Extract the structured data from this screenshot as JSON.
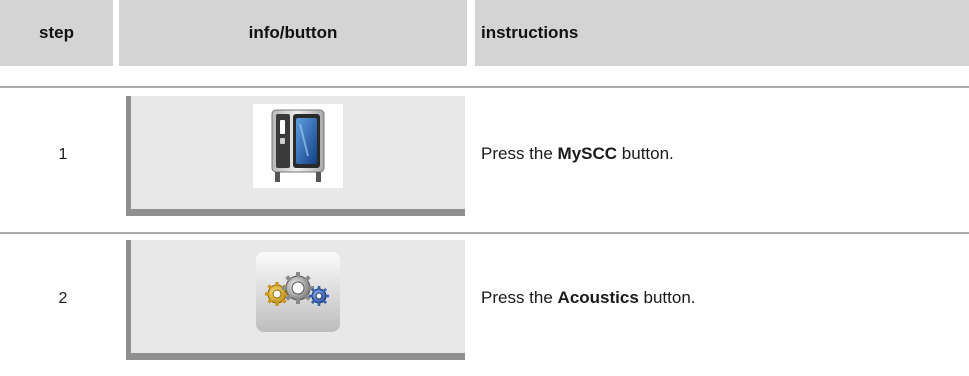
{
  "header": {
    "step_label": "step",
    "info_label": "info/button",
    "instructions_label": "instructions"
  },
  "rows": [
    {
      "step": "1",
      "icon": "myscc-oven-icon",
      "instruction_prefix": "Press the ",
      "instruction_bold": "MySCC",
      "instruction_suffix": " button."
    },
    {
      "step": "2",
      "icon": "acoustics-gears-icon",
      "instruction_prefix": "Press the ",
      "instruction_bold": "Acoustics",
      "instruction_suffix": " button."
    }
  ],
  "colors": {
    "header_bg": "#d4d4d4",
    "panel_bg": "#e8e8e8",
    "panel_border": "#8f8f8f",
    "rule": "#a9a9a9",
    "oven_window": "#1f5fae",
    "gear_gold": "#d9a520",
    "gear_silver": "#9a9a9a",
    "gear_blue": "#2f5fb0"
  }
}
